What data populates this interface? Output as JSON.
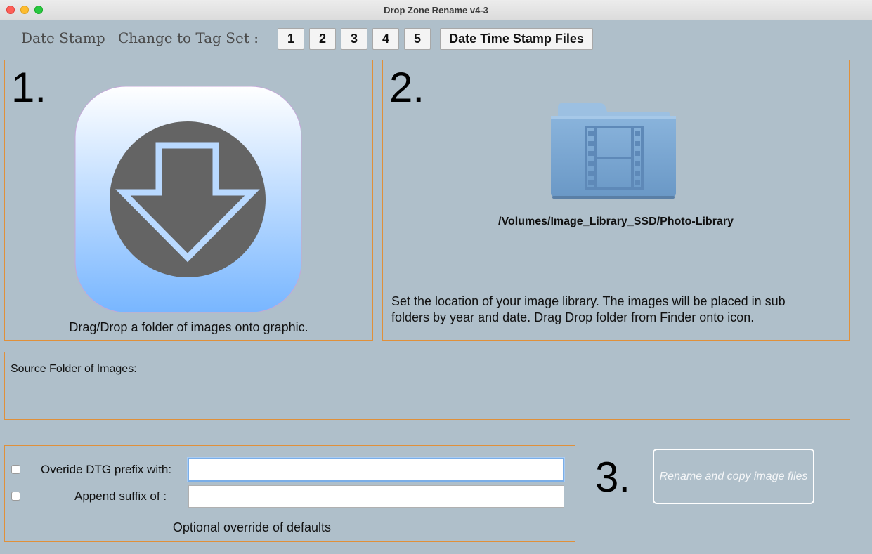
{
  "window": {
    "title": "Drop Zone Rename v4-3"
  },
  "toolbar": {
    "date_stamp_label": "Date Stamp",
    "change_tag_label": "Change to Tag Set :",
    "tag_buttons": [
      "1",
      "2",
      "3",
      "4",
      "5"
    ],
    "date_time_stamp_button": "Date Time Stamp Files"
  },
  "panel1": {
    "number": "1.",
    "icon": "download-arrow-icon",
    "caption": "Drag/Drop a folder of images onto graphic."
  },
  "panel2": {
    "number": "2.",
    "icon": "movies-folder-icon",
    "path": "/Volumes/Image_Library_SSD/Photo-Library",
    "help_line1": "Set the location of your image library.  The images will be placed in sub",
    "help_line2": "folders  by year and date.  Drag Drop folder from Finder onto icon."
  },
  "source": {
    "label": "Source Folder of Images:"
  },
  "options": {
    "override_label": "Overide DTG prefix with:",
    "override_value": "",
    "append_label": "Append suffix of :",
    "append_value": "",
    "footer": "Optional override of defaults"
  },
  "step3": {
    "number": "3.",
    "rename_button": "Rename and copy image files"
  },
  "colors": {
    "background": "#afbfca",
    "panel_border": "#e0903a",
    "icon_gradient_top": "#ffffff",
    "icon_gradient_bottom": "#78b6ff",
    "arrow_circle": "#646464"
  }
}
